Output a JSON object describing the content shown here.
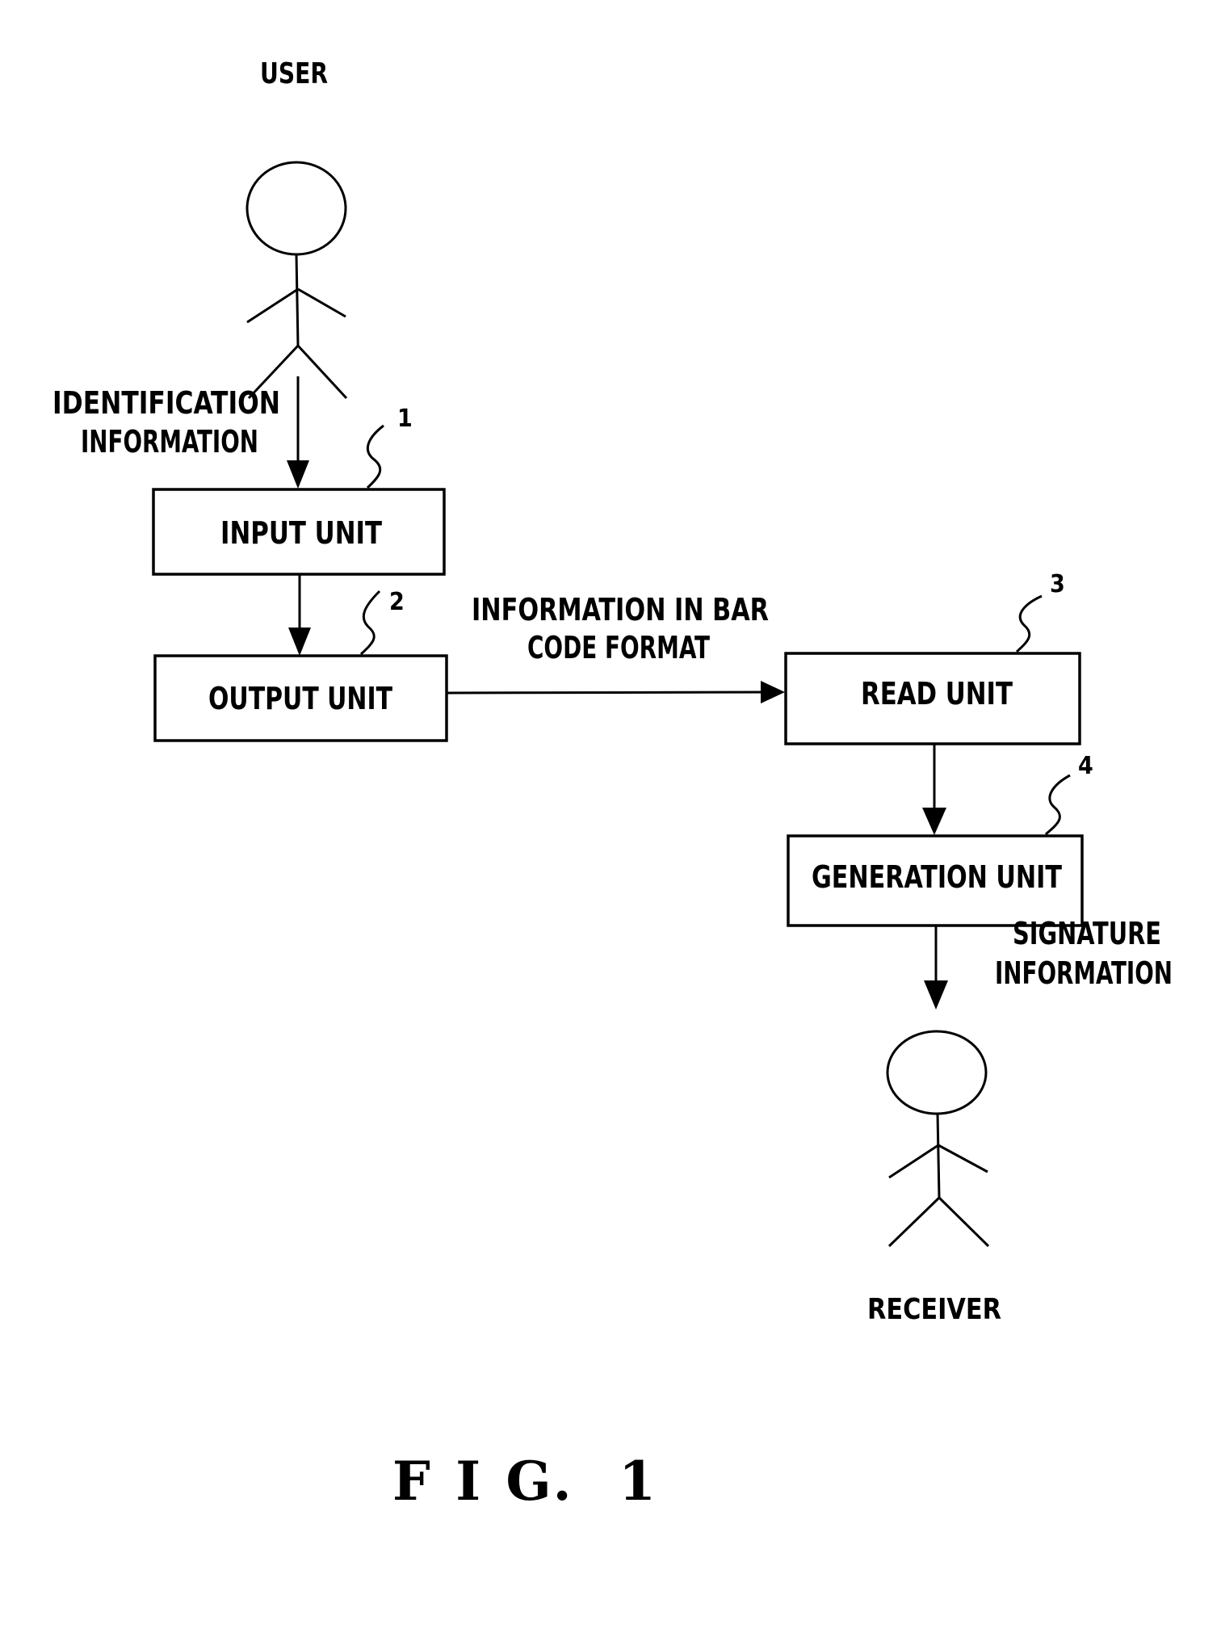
{
  "actors": {
    "user": "USER",
    "receiver": "RECEIVER"
  },
  "units": {
    "input": {
      "label": "INPUT UNIT",
      "ref": "1"
    },
    "output": {
      "label": "OUTPUT UNIT",
      "ref": "2"
    },
    "read": {
      "label": "READ UNIT",
      "ref": "3"
    },
    "generation": {
      "label": "GENERATION UNIT",
      "ref": "4"
    }
  },
  "flows": {
    "identification": [
      "IDENTIFICATION",
      "INFORMATION"
    ],
    "barcode": [
      "INFORMATION IN BAR",
      "CODE FORMAT"
    ],
    "signature": [
      "SIGNATURE",
      "INFORMATION"
    ]
  },
  "figure_caption": "F I G.  1"
}
